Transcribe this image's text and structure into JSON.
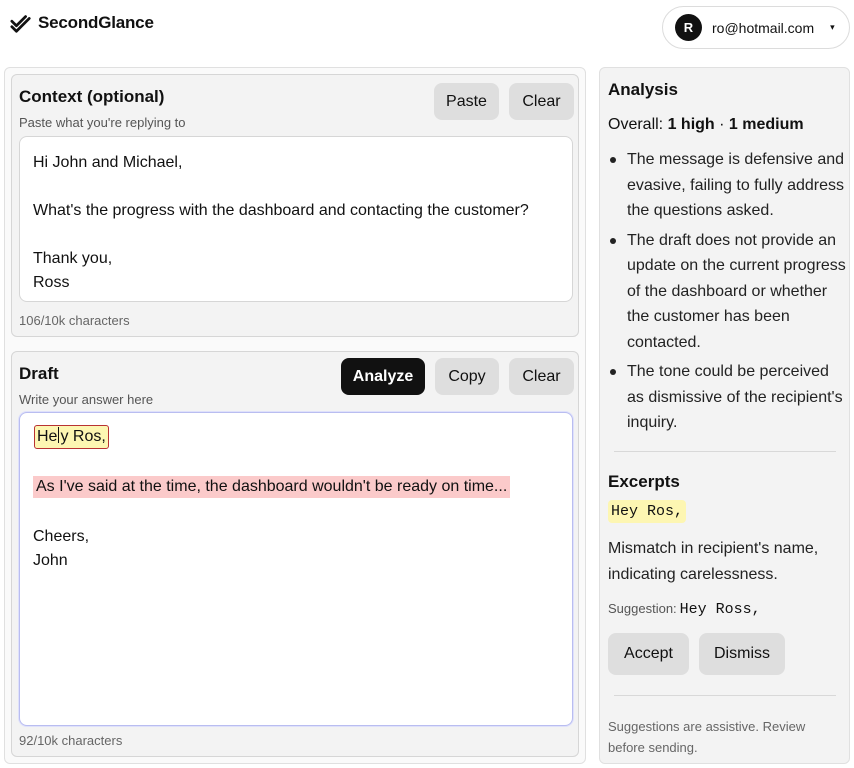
{
  "app": {
    "name": "SecondGlance",
    "logo_icon": "double-check-icon"
  },
  "account": {
    "avatar_initial": "R",
    "email": "ro@hotmail.com",
    "menu_caret": "▾"
  },
  "context": {
    "title": "Context (optional)",
    "subtitle": "Paste what you're replying to",
    "paste_label": "Paste",
    "clear_label": "Clear",
    "lines": [
      "Hi John and Michael,",
      "What's the progress with the dashboard and contacting the customer?",
      "Thank you,",
      "Ross"
    ],
    "counter": "106/10k characters"
  },
  "draft": {
    "title": "Draft",
    "subtitle": "Write your answer here",
    "analyze_label": "Analyze",
    "copy_label": "Copy",
    "clear_label": "Clear",
    "greeting_before_cursor": "He",
    "greeting_after_cursor": "y Ros,",
    "flagged_line": "As I've said at the time, the dashboard wouldn't be ready on time...",
    "signoff": "Cheers,",
    "signature": "John",
    "counter": "92/10k characters",
    "highlight_colors": {
      "high": "#fbcaca",
      "medium": "#fdf6b2"
    }
  },
  "analysis": {
    "title": "Analysis",
    "overall_label": "Overall:",
    "overall_high": "1 high",
    "overall_sep": "·",
    "overall_medium": "1 medium",
    "points": [
      "The message is defensive and evasive, failing to fully address the questions asked.",
      "The draft does not provide an update on the current progress of the dashboard or whether the customer has been contacted.",
      "The tone could be perceived as dismissive of the recipient's inquiry."
    ]
  },
  "excerpts": {
    "title": "Excerpts",
    "excerpt": "Hey Ros,",
    "description": "Mismatch in recipient's name, indicating carelessness.",
    "suggestion_label": "Suggestion:",
    "suggestion_value": "Hey Ross,",
    "accept_label": "Accept",
    "dismiss_label": "Dismiss"
  },
  "footer": {
    "note": "Suggestions are assistive. Review before sending."
  }
}
